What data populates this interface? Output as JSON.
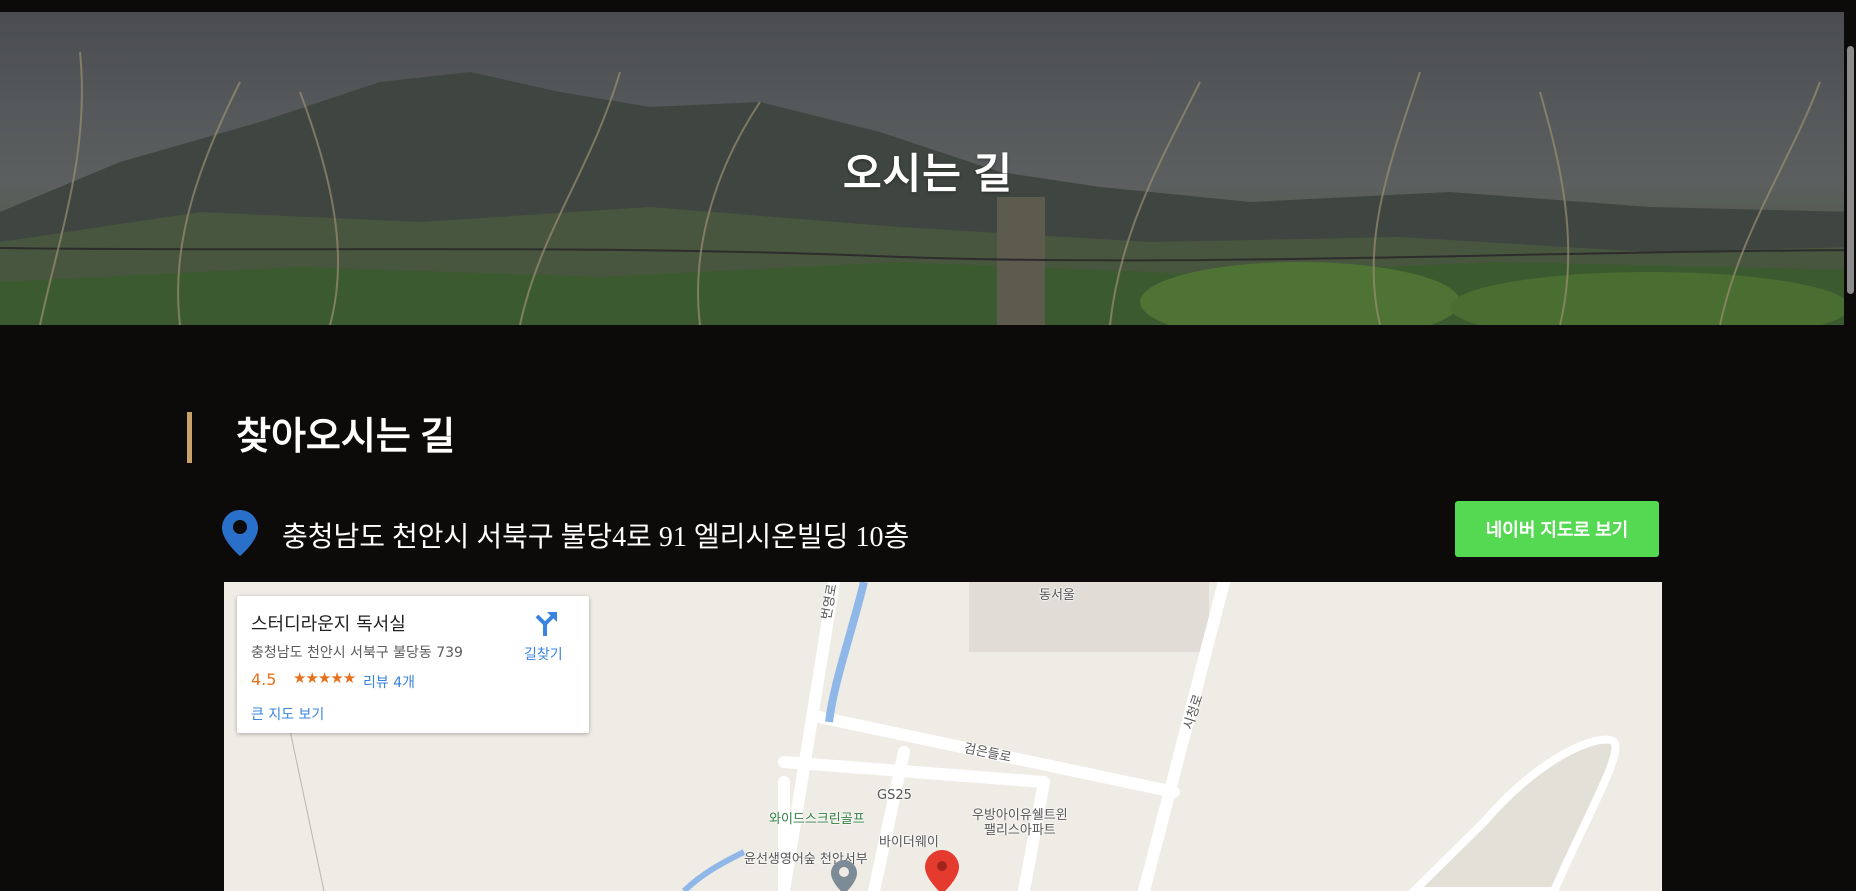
{
  "hero": {
    "title": "오시는 길"
  },
  "section": {
    "title": "찾아오시는 길"
  },
  "location": {
    "address": "충청남도 천안시 서북구 불당4로 91 엘리시온빌딩 10층",
    "pin_icon": "map-pin-icon",
    "pin_color": "#2a6fc9"
  },
  "naver_button": {
    "label": "네이버 지도로 보기",
    "color": "#55d952"
  },
  "accent_color": "#c9a26a",
  "map": {
    "card": {
      "name": "스터디라운지 독서실",
      "address": "충청남도 천안시 서북구 불당동 739",
      "rating": "4.5",
      "stars": "★★★★★",
      "reviews": "리뷰 4개",
      "large_map": "큰 지도 보기",
      "directions": "길찾기"
    },
    "labels": {
      "gs25": "GS25",
      "golf": "와이드스크린골프",
      "apt": "우방아이유쉘트윈",
      "apt2": "팰리스아파트",
      "buyway": "바이더웨이",
      "english": "윤선생영어숲 천안서부",
      "road1": "검은들로",
      "road2": "시청로",
      "road3": "번영로",
      "top": "동서울"
    }
  }
}
